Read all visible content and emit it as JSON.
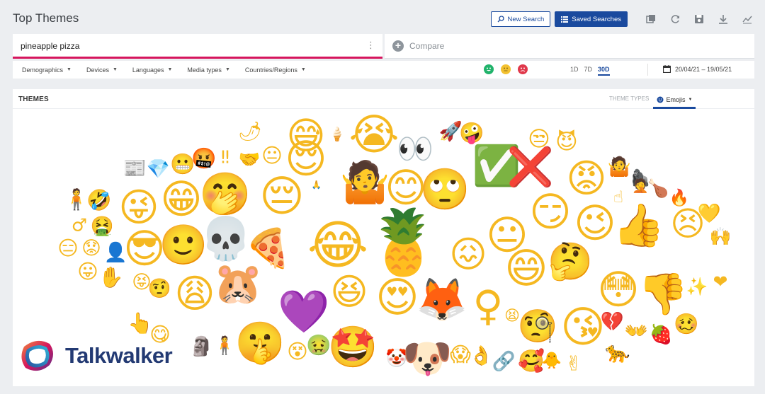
{
  "header": {
    "title": "Top Themes"
  },
  "toolbar": {
    "new_search_label": "New Search",
    "saved_searches_label": "Saved Searches",
    "icons": [
      "copy-icon",
      "refresh-icon",
      "save-icon",
      "download-icon",
      "trend-icon"
    ]
  },
  "search": {
    "query": "pineapple pizza",
    "compare_label": "Compare"
  },
  "filters": {
    "items": [
      "Demographics",
      "Devices",
      "Languages",
      "Media types",
      "Countries/Regions"
    ],
    "sentiments": [
      "positive",
      "neutral",
      "negative"
    ],
    "periods": [
      "1D",
      "7D",
      "30D"
    ],
    "active_period": "30D",
    "date_range": "20/04/21 – 19/05/21"
  },
  "panel": {
    "title": "THEMES",
    "theme_types_label": "THEME TYPES",
    "emoji_tab_label": "Emojis"
  },
  "emoji_cloud": [
    {
      "name": "hot-pepper",
      "glyph": "🌶"
    },
    {
      "name": "grinning-sweat",
      "glyph": "😅"
    },
    {
      "name": "soft-ice-cream",
      "glyph": "🍦"
    },
    {
      "name": "crying",
      "glyph": "😭"
    },
    {
      "name": "eyes",
      "glyph": "👀"
    },
    {
      "name": "rocket",
      "glyph": "🚀"
    },
    {
      "name": "zany-face",
      "glyph": "🤪"
    },
    {
      "name": "newspaper",
      "glyph": "📰"
    },
    {
      "name": "gem",
      "glyph": "💎"
    },
    {
      "name": "grimacing",
      "glyph": "😬"
    },
    {
      "name": "cursing",
      "glyph": "🤬"
    },
    {
      "name": "double-exclamation",
      "glyph": "‼"
    },
    {
      "name": "handshake",
      "glyph": "🤝"
    },
    {
      "name": "neutral",
      "glyph": "😐"
    },
    {
      "name": "relieved",
      "glyph": "😌"
    },
    {
      "name": "check-mark",
      "glyph": "✅"
    },
    {
      "name": "cross-mark",
      "glyph": "❌"
    },
    {
      "name": "unamused",
      "glyph": "😒"
    },
    {
      "name": "smiling-imp",
      "glyph": "😈"
    },
    {
      "name": "angry",
      "glyph": "😡"
    },
    {
      "name": "shrug",
      "glyph": "🤷"
    },
    {
      "name": "gorilla",
      "glyph": "🦍"
    },
    {
      "name": "woman-shrugging",
      "glyph": "🤷"
    },
    {
      "name": "blush",
      "glyph": "😊"
    },
    {
      "name": "face-with-rolling-eyes",
      "glyph": "🙄"
    },
    {
      "name": "pensive",
      "glyph": "😔"
    },
    {
      "name": "folded-hands",
      "glyph": "🙏"
    },
    {
      "name": "person-standing",
      "glyph": "🧍"
    },
    {
      "name": "rofl",
      "glyph": "🤣"
    },
    {
      "name": "wink",
      "glyph": "😜"
    },
    {
      "name": "grin",
      "glyph": "😁"
    },
    {
      "name": "hand-over-mouth",
      "glyph": "🤭"
    },
    {
      "name": "poultry-leg",
      "glyph": "🍗"
    },
    {
      "name": "point-up",
      "glyph": "☝"
    },
    {
      "name": "facepalm",
      "glyph": "🤦"
    },
    {
      "name": "fire",
      "glyph": "🔥"
    },
    {
      "name": "yellow-heart",
      "glyph": "💛"
    },
    {
      "name": "male-sign",
      "glyph": "♂"
    },
    {
      "name": "nauseated",
      "glyph": "🤮"
    },
    {
      "name": "sunglasses",
      "glyph": "😎"
    },
    {
      "name": "slightly-smiling",
      "glyph": "🙂"
    },
    {
      "name": "skull",
      "glyph": "💀"
    },
    {
      "name": "pizza",
      "glyph": "🍕"
    },
    {
      "name": "joy",
      "glyph": "😂"
    },
    {
      "name": "pineapple",
      "glyph": "🍍"
    },
    {
      "name": "confounded",
      "glyph": "😖"
    },
    {
      "name": "neutral-face",
      "glyph": "😐"
    },
    {
      "name": "smirk",
      "glyph": "😏"
    },
    {
      "name": "winking",
      "glyph": "😉"
    },
    {
      "name": "thumbs-up",
      "glyph": "👍"
    },
    {
      "name": "persevering",
      "glyph": "😣"
    },
    {
      "name": "raised-hands",
      "glyph": "🙌"
    },
    {
      "name": "expressionless",
      "glyph": "😑"
    },
    {
      "name": "worried",
      "glyph": "😟"
    },
    {
      "name": "bust-silhouette",
      "glyph": "👤"
    },
    {
      "name": "tongue-out",
      "glyph": "😛"
    },
    {
      "name": "raised-hand",
      "glyph": "✋"
    },
    {
      "name": "squinting-tongue",
      "glyph": "😝"
    },
    {
      "name": "face-with-raised-eyebrow",
      "glyph": "🤨"
    },
    {
      "name": "weary",
      "glyph": "😩"
    },
    {
      "name": "hamster",
      "glyph": "🐹"
    },
    {
      "name": "purple-heart",
      "glyph": "💜"
    },
    {
      "name": "laughing",
      "glyph": "😆"
    },
    {
      "name": "heart-eyes",
      "glyph": "😍"
    },
    {
      "name": "fox",
      "glyph": "🦊"
    },
    {
      "name": "female-sign",
      "glyph": "♀"
    },
    {
      "name": "grinning",
      "glyph": "😄"
    },
    {
      "name": "thinking",
      "glyph": "🤔"
    },
    {
      "name": "flushed",
      "glyph": "😳"
    },
    {
      "name": "thumbs-down",
      "glyph": "👎"
    },
    {
      "name": "sparkles",
      "glyph": "✨"
    },
    {
      "name": "red-heart",
      "glyph": "❤"
    },
    {
      "name": "tired-face",
      "glyph": "😫"
    },
    {
      "name": "monocle",
      "glyph": "🧐"
    },
    {
      "name": "kissing",
      "glyph": "😘"
    },
    {
      "name": "broken-heart",
      "glyph": "💔"
    },
    {
      "name": "open-hands",
      "glyph": "👐"
    },
    {
      "name": "strawberry",
      "glyph": "🍓"
    },
    {
      "name": "woozy",
      "glyph": "🥴"
    },
    {
      "name": "point-up-2",
      "glyph": "👆"
    },
    {
      "name": "yum",
      "glyph": "😋"
    },
    {
      "name": "moai",
      "glyph": "🗿"
    },
    {
      "name": "man-standing",
      "glyph": "🧍"
    },
    {
      "name": "shushing",
      "glyph": "🤫"
    },
    {
      "name": "face-with-spiral",
      "glyph": "😵"
    },
    {
      "name": "sick-face",
      "glyph": "🤢"
    },
    {
      "name": "star-struck",
      "glyph": "🤩"
    },
    {
      "name": "clown",
      "glyph": "🤡"
    },
    {
      "name": "dog",
      "glyph": "🐶"
    },
    {
      "name": "scream",
      "glyph": "😱"
    },
    {
      "name": "ok-hand",
      "glyph": "👌"
    },
    {
      "name": "link",
      "glyph": "🔗"
    },
    {
      "name": "smiling-hearts",
      "glyph": "🥰"
    },
    {
      "name": "chick",
      "glyph": "🐥"
    },
    {
      "name": "victory-hand",
      "glyph": "✌"
    },
    {
      "name": "leopard",
      "glyph": "🐆"
    }
  ],
  "brand": {
    "logo_text": "Talkwalker",
    "accent": "#1a4a9e",
    "highlight": "#d6155d"
  }
}
